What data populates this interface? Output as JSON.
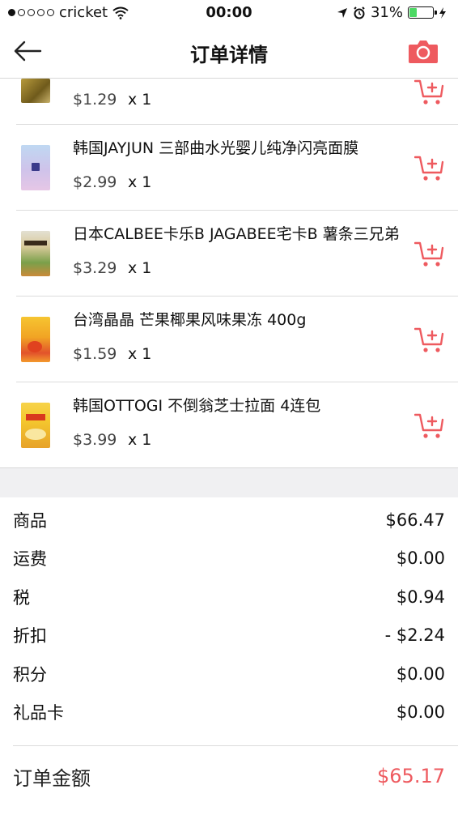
{
  "status_bar": {
    "carrier": "cricket",
    "time": "00:00",
    "battery": "31%",
    "battery_level": 0.31
  },
  "nav": {
    "title": "订单详情"
  },
  "items": [
    {
      "name": "",
      "price": "$1.29",
      "qty": "x 1"
    },
    {
      "name": "韩国JAYJUN 三部曲水光婴儿纯净闪亮面膜",
      "price": "$2.99",
      "qty": "x 1"
    },
    {
      "name": "日本CALBEE卡乐B JAGABEE宅卡B 薯条三兄弟",
      "price": "$3.29",
      "qty": "x 1"
    },
    {
      "name": "台湾晶晶 芒果椰果风味果冻 400g",
      "price": "$1.59",
      "qty": "x 1"
    },
    {
      "name": "韩国OTTOGI 不倒翁芝士拉面 4连包",
      "price": "$3.99",
      "qty": "x 1"
    }
  ],
  "summary": [
    {
      "label": "商品",
      "value": "$66.47"
    },
    {
      "label": "运费",
      "value": "$0.00"
    },
    {
      "label": "税",
      "value": "$0.94"
    },
    {
      "label": "折扣",
      "value": "- $2.24"
    },
    {
      "label": "积分",
      "value": "$0.00"
    },
    {
      "label": "礼品卡",
      "value": "$0.00"
    }
  ],
  "total": {
    "label": "订单金额",
    "value": "$65.17"
  },
  "colors": {
    "accent": "#ee5a5f",
    "battery": "#4cd964"
  },
  "icons": [
    "back-arrow-icon",
    "camera-icon",
    "add-to-cart-icon",
    "wifi-icon",
    "location-icon",
    "alarm-icon",
    "charging-icon"
  ]
}
